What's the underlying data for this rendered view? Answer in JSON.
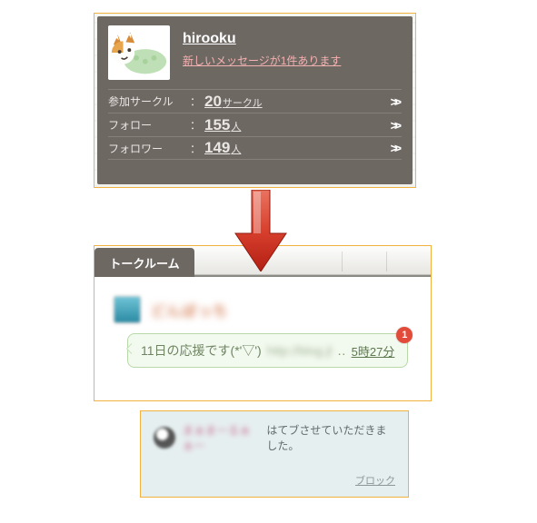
{
  "profile": {
    "username": "hirooku",
    "new_message_text": "新しいメッセージが1件あります",
    "stats": {
      "circles": {
        "label": "参加サークル",
        "num": "20",
        "unit": "サークル"
      },
      "follow": {
        "label": "フォロー",
        "num": "155",
        "unit": "人"
      },
      "follower": {
        "label": "フォロワー",
        "num": "149",
        "unit": "人"
      }
    }
  },
  "talkroom": {
    "tab_label": "トークルーム",
    "user_name_blurred": "どんぼっち",
    "bubble_text": "11日の応援です(*'▽')",
    "bubble_blurred": "http://blog.jl",
    "bubble_dots": "‥",
    "bubble_time": "5時27分",
    "badge_count": "1"
  },
  "reply": {
    "user_name_blurred": "まぁまーるぁぁー",
    "text": "はてブさせていただきました。",
    "block_label": "ブロック"
  }
}
